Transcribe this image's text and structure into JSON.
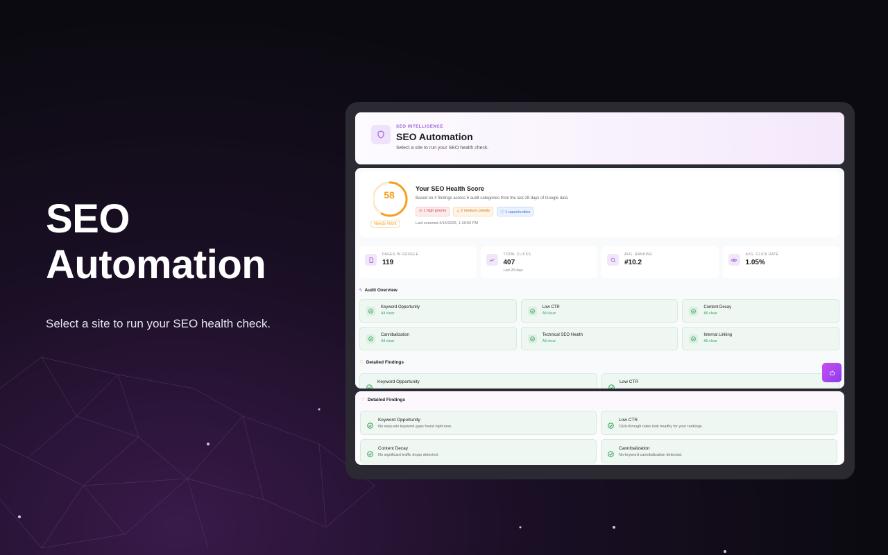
{
  "hero": {
    "title_line1": "SEO",
    "title_line2": "Automation",
    "subtitle": "Select a site to run your SEO health check."
  },
  "header": {
    "kicker": "SEO INTELLIGENCE",
    "title": "SEO Automation",
    "subtitle": "Select a site to run your SEO health check.",
    "icon": "shield-icon"
  },
  "health": {
    "score": "58",
    "score_value": 58,
    "status": "Needs Work",
    "title": "Your SEO Health Score",
    "description": "Based on 4 findings across 6 audit categories from the last 28 days of Google data",
    "chips": {
      "high": "1 high priority",
      "medium": "2 medium priority",
      "opportunities": "1 opportunities"
    },
    "last_scanned": "Last scanned 4/16/2026, 1:18:50 PM"
  },
  "stats": [
    {
      "label": "PAGES IN GOOGLE",
      "value": "119",
      "hint": "",
      "icon": "document-icon"
    },
    {
      "label": "TOTAL CLICKS",
      "value": "407",
      "hint": "Last 28 days",
      "icon": "trend-up-icon"
    },
    {
      "label": "AVG. RANKING",
      "value": "#10.2",
      "hint": "",
      "icon": "search-icon"
    },
    {
      "label": "AVG. CLICK RATE",
      "value": "1.05%",
      "hint": "",
      "icon": "eye-icon"
    }
  ],
  "audit": {
    "heading": "Audit Overview",
    "items": [
      {
        "name": "Keyword Opportunity",
        "status": "All clear"
      },
      {
        "name": "Low CTR",
        "status": "All clear"
      },
      {
        "name": "Content Decay",
        "status": "All clear"
      },
      {
        "name": "Cannibalization",
        "status": "All clear"
      },
      {
        "name": "Technical SEO Health",
        "status": "All clear"
      },
      {
        "name": "Internal Linking",
        "status": "All clear"
      }
    ]
  },
  "findings_preview": {
    "heading": "Detailed Findings",
    "items": [
      "Keyword Opportunity",
      "Low CTR"
    ]
  },
  "findings": {
    "heading": "Detailed Findings",
    "items": [
      {
        "name": "Keyword Opportunity",
        "desc": "No easy-win keyword gaps found right now."
      },
      {
        "name": "Low CTR",
        "desc": "Click-through rates look healthy for your rankings."
      },
      {
        "name": "Content Decay",
        "desc": "No significant traffic drops detected."
      },
      {
        "name": "Cannibalization",
        "desc": "No keyword cannibalization detected."
      }
    ]
  },
  "colors": {
    "accent": "#9a5bd8",
    "score": "#f5a01f",
    "ok": "#3fa463"
  }
}
